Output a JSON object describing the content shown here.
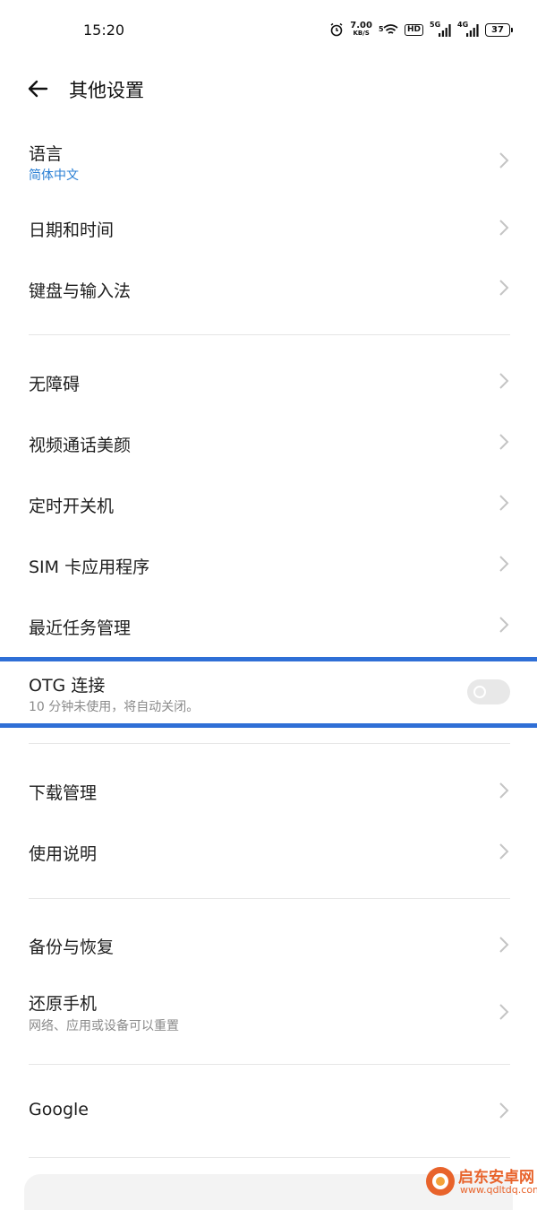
{
  "status_bar": {
    "time": "15:20",
    "net_speed_value": "7.00",
    "net_speed_unit": "KB/S",
    "wifi_tag": "5",
    "hd_badge": "HD",
    "signal1_tag": "5G",
    "signal2_tag": "4G",
    "battery": "37"
  },
  "header": {
    "title": "其他设置"
  },
  "items": [
    {
      "label": "语言",
      "sub": "简体中文"
    },
    {
      "label": "日期和时间"
    },
    {
      "label": "键盘与输入法"
    },
    {
      "label": "无障碍"
    },
    {
      "label": "视频通话美颜"
    },
    {
      "label": "定时开关机"
    },
    {
      "label": "SIM 卡应用程序"
    },
    {
      "label": "最近任务管理"
    },
    {
      "label": "OTG 连接",
      "sub": "10 分钟未使用，将自动关闭。",
      "toggle_on": false
    },
    {
      "label": "下载管理"
    },
    {
      "label": "使用说明"
    },
    {
      "label": "备份与恢复"
    },
    {
      "label": "还原手机",
      "sub": "网络、应用或设备可以重置"
    },
    {
      "label": "Google"
    }
  ],
  "colors": {
    "accent": "#2a7fd4",
    "highlight": "#2f6fd6",
    "watermark": "#e8632b"
  },
  "watermark": {
    "name": "启东安卓网",
    "url": "www.qdltdq.com"
  }
}
